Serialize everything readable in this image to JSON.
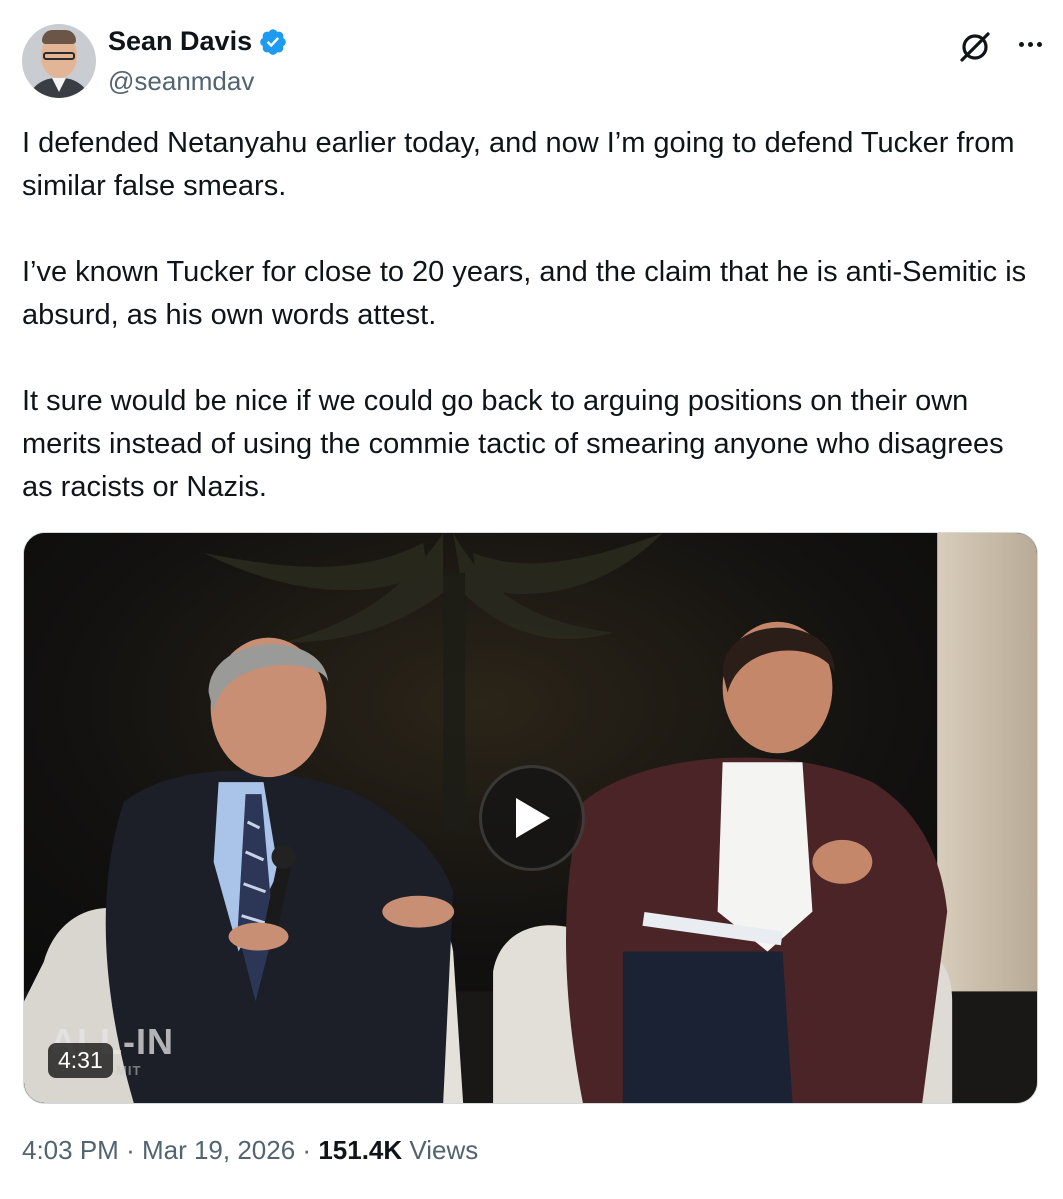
{
  "author": {
    "display_name": "Sean Davis",
    "handle": "@seanmdav",
    "verified": true,
    "verified_color": "#1d9bf0"
  },
  "tweet": {
    "paragraphs": [
      "I defended Netanyahu earlier today, and now I’m going to defend Tucker from similar false smears.",
      "I’ve known Tucker for close to 20 years, and the claim that he is anti-Semitic is absurd, as his own words attest.",
      "It sure would be nice if we could go back to arguing positions on their own merits instead of using the commie tactic of smearing anyone who disagrees as racists or Nazis."
    ]
  },
  "media": {
    "type": "video",
    "duration": "4:31",
    "watermark": "ALL-IN",
    "watermark_sub": "MIT"
  },
  "meta": {
    "time": "4:03 PM",
    "separator": "·",
    "date": "Mar 19, 2026",
    "views_count": "151.4K",
    "views_label": "Views"
  },
  "icons": {
    "header_right": [
      "grok-icon",
      "more-icon"
    ],
    "media": [
      "play-icon"
    ]
  }
}
